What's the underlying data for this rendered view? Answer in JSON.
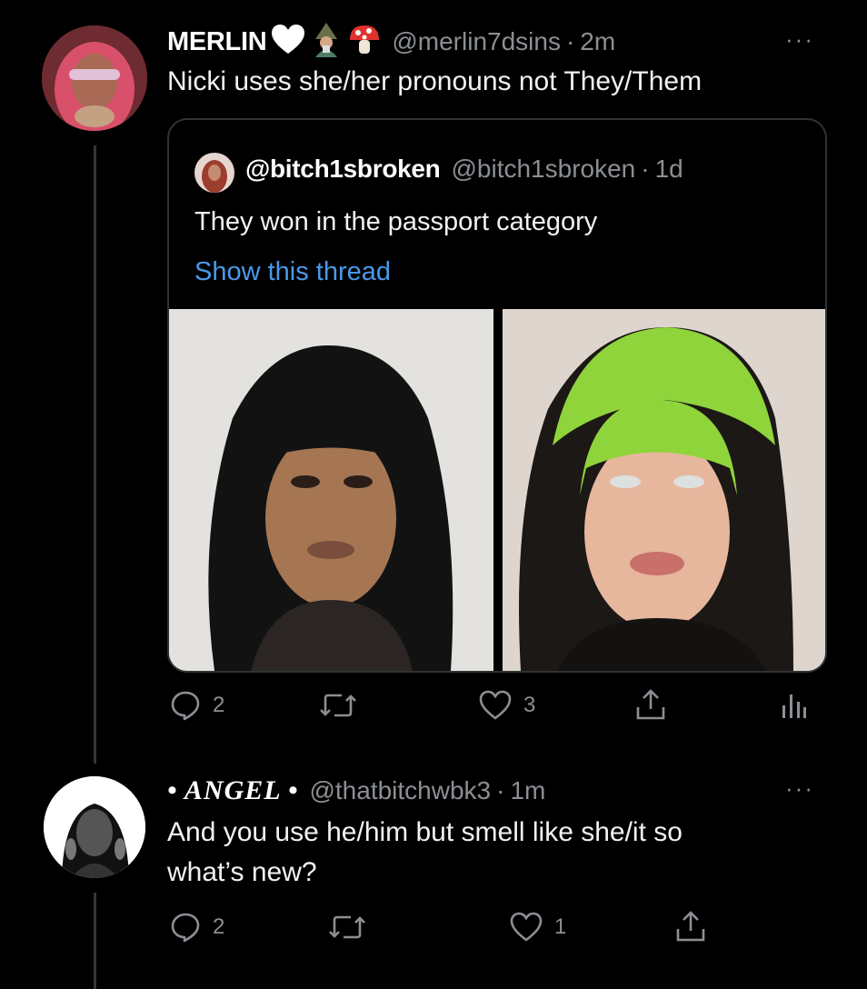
{
  "tweet1": {
    "name": "MERLIN",
    "emoji_icons": [
      "white-heart-icon",
      "mage-icon",
      "mushroom-icon"
    ],
    "handle": "@merlin7dsins",
    "sep": "·",
    "time": "2m",
    "more": "···",
    "text": "Nicki uses she/her pronouns not They/Them",
    "quote": {
      "name": "@bitch1sbroken",
      "handle": "@bitch1sbroken",
      "sep": "·",
      "time": "1d",
      "text": "They won in the passport category",
      "link": "Show this thread"
    },
    "actions": {
      "replies": "2",
      "retweets": "",
      "likes": "3"
    }
  },
  "tweet2": {
    "name": "• ANGEL •",
    "handle": "@thatbitchwbk3",
    "sep": "·",
    "time": "1m",
    "more": "···",
    "text_line1": "And you use he/him but smell like she/it so",
    "text_line2": "what’s new?",
    "actions": {
      "replies": "2",
      "retweets": "",
      "likes": "1"
    }
  },
  "colors": {
    "background": "#000000",
    "link": "#4a99e9",
    "muted": "#8b8f94",
    "text": "#e7e9ea"
  }
}
